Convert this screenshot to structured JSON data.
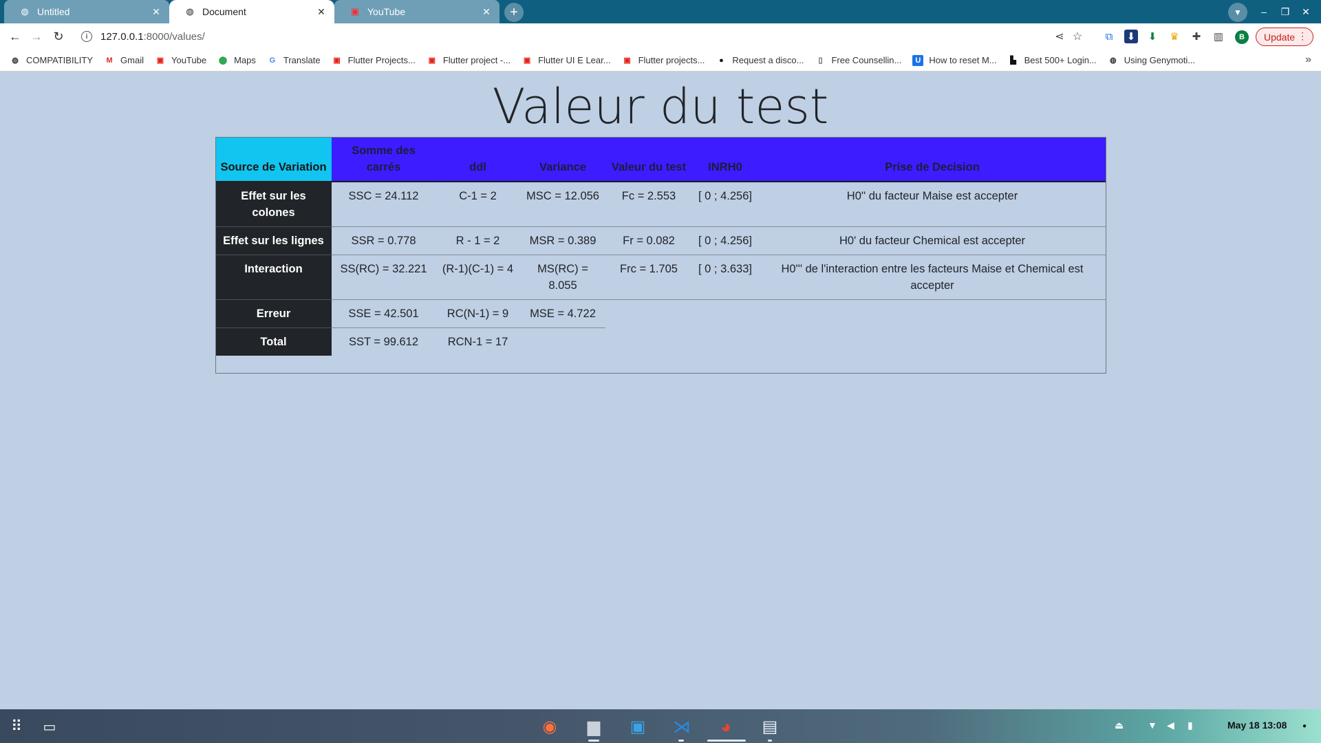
{
  "browser": {
    "tabs": [
      {
        "label": "Untitled",
        "icon": "globe-icon",
        "active": false
      },
      {
        "label": "Document",
        "icon": "globe-icon",
        "active": true
      },
      {
        "label": "YouTube",
        "icon": "youtube-icon",
        "active": false
      }
    ],
    "url": {
      "host": "127.0.0.1",
      "rest": ":8000/values/"
    },
    "update_label": "Update",
    "profile_initial": "B"
  },
  "bookmarks": [
    {
      "label": "COMPATIBILITY",
      "icon": "globe-icon"
    },
    {
      "label": "Gmail",
      "icon": "gmail-icon"
    },
    {
      "label": "YouTube",
      "icon": "youtube-icon"
    },
    {
      "label": "Maps",
      "icon": "maps-icon"
    },
    {
      "label": "Translate",
      "icon": "translate-icon"
    },
    {
      "label": "Flutter Projects...",
      "icon": "youtube-icon"
    },
    {
      "label": "Flutter project -...",
      "icon": "youtube-icon"
    },
    {
      "label": "Flutter UI E Lear...",
      "icon": "youtube-icon"
    },
    {
      "label": "Flutter projects...",
      "icon": "youtube-icon"
    },
    {
      "label": "Request a disco...",
      "icon": "github-icon"
    },
    {
      "label": "Free Counsellin...",
      "icon": "document-icon"
    },
    {
      "label": "How to reset M...",
      "icon": "udemy-icon"
    },
    {
      "label": "Best 500+ Login...",
      "icon": "lock-icon"
    },
    {
      "label": "Using Genymoti...",
      "icon": "globe-icon"
    }
  ],
  "page": {
    "title": "Valeur du test",
    "table": {
      "headers": {
        "source": "Source de Variation",
        "somme": "Somme des carrés",
        "ddl": "ddl",
        "variance": "Variance",
        "valeur": "Valeur du test",
        "inrho": "INRH0",
        "decision": "Prise de Decision"
      },
      "rows": {
        "colones": {
          "label": "Effet sur les colones",
          "somme": "SSC = 24.112",
          "ddl": "C-1 = 2",
          "variance": "MSC = 12.056",
          "valeur": "Fc = 2.553",
          "inrho": "[ 0 ; 4.256]",
          "decision": "H0'' du facteur Maise est accepter"
        },
        "lignes": {
          "label": "Effet sur les lignes",
          "somme": "SSR = 0.778",
          "ddl": "R - 1 = 2",
          "variance": "MSR = 0.389",
          "valeur": "Fr = 0.082",
          "inrho": "[ 0 ; 4.256]",
          "decision": "H0' du facteur Chemical est accepter"
        },
        "interaction": {
          "label": "Interaction",
          "somme": "SS(RC) = 32.221",
          "ddl": "(R-1)(C-1) = 4",
          "variance": "MS(RC) = 8.055",
          "valeur": "Frc = 1.705",
          "inrho": "[ 0 ; 3.633]",
          "decision": "H0''' de l'interaction entre les facteurs Maise et Chemical est accepter"
        },
        "erreur": {
          "label": "Erreur",
          "somme": "SSE = 42.501",
          "ddl": "RC(N-1) = 9",
          "variance": "MSE = 4.722"
        },
        "total": {
          "label": "Total",
          "somme": "SST = 99.612",
          "ddl": "RCN-1 = 17"
        }
      }
    }
  },
  "taskbar": {
    "clock": "May 18  13:08",
    "apps": [
      "firefox-icon",
      "files-icon",
      "store-icon",
      "vscode-icon",
      "chrome-icon",
      "docs-icon"
    ]
  },
  "colors": {
    "page_bg": "#bfcfe4",
    "header_bg": "#3d1cff",
    "source_header_bg": "#11c5f0",
    "rowhead_bg": "#212529",
    "tabstrip_bg": "#0f5f80"
  }
}
